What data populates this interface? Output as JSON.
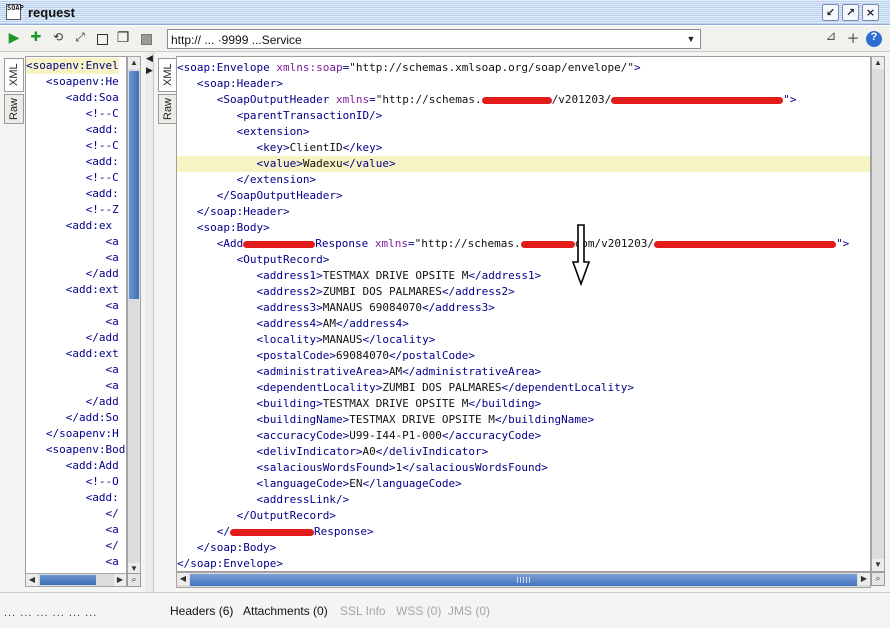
{
  "window": {
    "title": "request",
    "app_icon_label": "SOAP"
  },
  "toolbar": {
    "url": "http://               ...                    ·9999                   ...Service",
    "buttons": [
      "run-icon",
      "add-icon",
      "refresh-icon",
      "expand-icon",
      "square-icon",
      "clone-icon",
      "stop-icon"
    ],
    "right_help": "?"
  },
  "left_tabs": [
    "XML",
    "Raw"
  ],
  "right_tabs": [
    "XML",
    "Raw"
  ],
  "left_lines": [
    "<soapenv:Envel",
    "   <soapenv:He",
    "      <add:Soa",
    "         <!--C",
    "         <add:",
    "         <!--C",
    "         <add:",
    "         <!--C",
    "         <add:",
    "         <!--Z",
    "      <add:ex",
    "            <a",
    "            <a",
    "         </add",
    "      <add:ext",
    "            <a",
    "            <a",
    "         </add",
    "      <add:ext",
    "            <a",
    "            <a",
    "         </add",
    "      </add:So",
    "   </soapenv:H",
    "   <soapenv:Bod",
    "      <add:Add",
    "         <!--O",
    "         <add:",
    "            </",
    "            <a",
    "            </",
    "            <a"
  ],
  "xml": {
    "envelope_open": "<soap:Envelope",
    "envelope_attr": "xmlns:soap",
    "envelope_val": "\"http://schemas.xmlsoap.org/soap/envelope/\"",
    "header_open": "<soap:Header>",
    "soh_open": "<SoapOutputHeader",
    "soh_attr": "xmlns",
    "soh_val_a": "\"http://schemas.",
    "soh_val_b": "/v201203/",
    "soh_val_c": "\">",
    "parent_tx": "<parentTransactionID/>",
    "extension_open": "<extension>",
    "key_open": "<key>",
    "key_val": "ClientID",
    "key_close": "</key>",
    "value_open": "<value>",
    "value_val": "Wadexu",
    "value_close": "</value>",
    "extension_close": "</extension>",
    "soh_close": "</SoapOutputHeader>",
    "header_close": "</soap:Header>",
    "body_open": "<soap:Body>",
    "resp_open_a": "<Add",
    "resp_open_b": "Response",
    "resp_attr": "xmlns",
    "resp_val_a": "\"http://schemas.",
    "resp_val_b": "com/v201203/",
    "resp_val_c": "\">",
    "output_open": "<OutputRecord>",
    "fields": [
      {
        "tag": "address1",
        "value": "TESTMAX DRIVE OPSITE M"
      },
      {
        "tag": "address2",
        "value": "ZUMBI DOS PALMARES"
      },
      {
        "tag": "address3",
        "value": "MANAUS 69084070"
      },
      {
        "tag": "address4",
        "value": "AM"
      },
      {
        "tag": "locality",
        "value": "MANAUS"
      },
      {
        "tag": "postalCode",
        "value": "69084070"
      },
      {
        "tag": "administrativeArea",
        "value": "AM"
      },
      {
        "tag": "dependentLocality",
        "value": "ZUMBI DOS PALMARES"
      },
      {
        "tag": "building",
        "value": "TESTMAX DRIVE OPSITE M"
      },
      {
        "tag": "buildingName",
        "value": "TESTMAX DRIVE OPSITE M"
      },
      {
        "tag": "accuracyCode",
        "value": "U99-I44-P1-000"
      },
      {
        "tag": "delivIndicator",
        "value": "A0"
      },
      {
        "tag": "salaciousWordsFound",
        "value": "1"
      },
      {
        "tag": "languageCode",
        "value": "EN"
      }
    ],
    "address_link": "<addressLink/>",
    "output_close": "</OutputRecord>",
    "resp_close_a": "</",
    "resp_close_b": "Response>",
    "body_close": "</soap:Body>",
    "envelope_close": "</soap:Envelope>"
  },
  "bottom_tabs": [
    {
      "label": "Headers (6)",
      "enabled": true
    },
    {
      "label": "Attachments (0)",
      "enabled": true
    },
    {
      "label": "SSL Info",
      "enabled": false
    },
    {
      "label": "WSS (0)",
      "enabled": false
    },
    {
      "label": "JMS (0)",
      "enabled": false
    }
  ],
  "left_status": "... ... ... ... ... ..."
}
